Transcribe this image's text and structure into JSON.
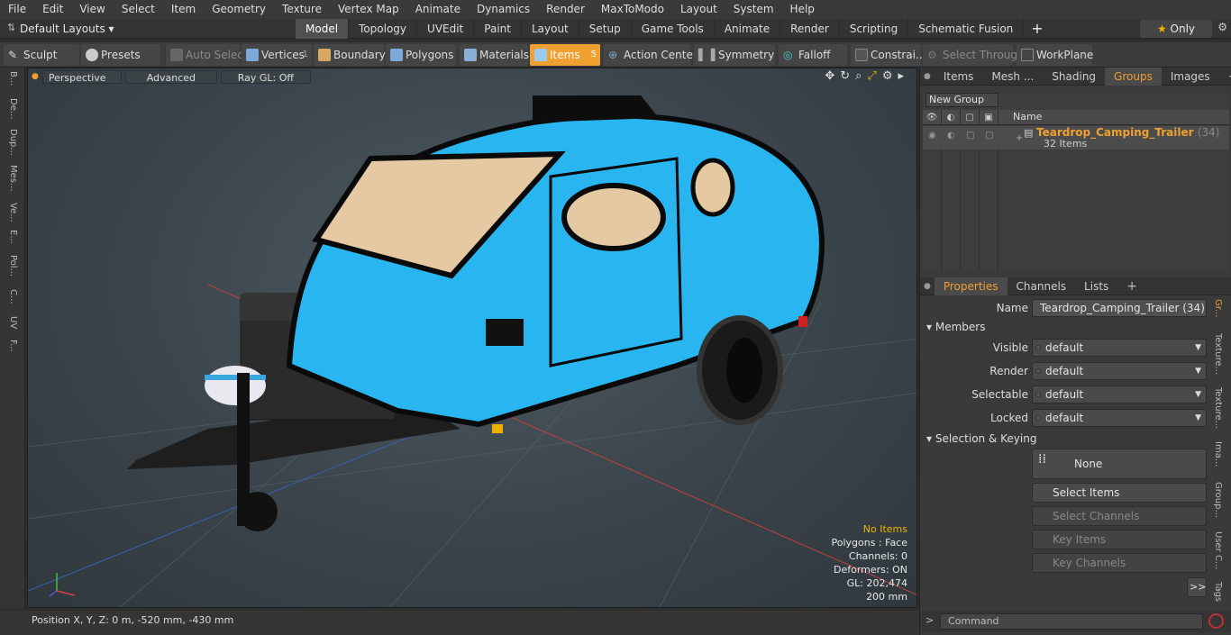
{
  "menu": [
    "File",
    "Edit",
    "View",
    "Select",
    "Item",
    "Geometry",
    "Texture",
    "Vertex Map",
    "Animate",
    "Dynamics",
    "Render",
    "MaxToModo",
    "Layout",
    "System",
    "Help"
  ],
  "layouts": {
    "label": "Default Layouts"
  },
  "modes": {
    "tabs": [
      "Model",
      "Topology",
      "UVEdit",
      "Paint",
      "Layout",
      "Setup",
      "Game Tools",
      "Animate",
      "Render",
      "Scripting",
      "Schematic Fusion"
    ],
    "active": "Model",
    "only_label": "Only"
  },
  "toolbar": {
    "sculpt": "Sculpt",
    "presets": "Presets",
    "auto_select": "Auto Select",
    "vertices": "Vertices",
    "vertices_count": "1",
    "boundary": "Boundary",
    "polygons": "Polygons",
    "materials": "Materials",
    "items": "Items",
    "items_count": "5",
    "action_center": "Action Center",
    "symmetry": "Symmetry",
    "falloff": "Falloff",
    "constraints": "Constrai...",
    "select_through": "Select Through",
    "workplane": "WorkPlane"
  },
  "left_tabs": [
    "B...",
    "De...",
    "Dup...",
    "Mes...",
    "Ve...",
    "E...",
    "Pol...",
    "C...",
    "UV",
    "F..."
  ],
  "viewport": {
    "view": "Perspective",
    "shading": "Advanced",
    "raygl": "Ray GL: Off",
    "hud": {
      "no_items": "No Items",
      "polygons": "Polygons : Face",
      "channels": "Channels: 0",
      "deformers": "Deformers: ON",
      "gl": "GL: 202,474",
      "scale": "200 mm"
    }
  },
  "status": {
    "position": "Position X, Y, Z:   0 m, -520 mm, -430 mm"
  },
  "right_top_tabs": [
    "Items",
    "Mesh ...",
    "Shading",
    "Groups",
    "Images"
  ],
  "right_top_active": "Groups",
  "groups": {
    "new_group": "New Group",
    "col_name": "Name",
    "group_name": "Teardrop_Camping_Trailer",
    "group_count": "(34)",
    "group_items": "32 Items"
  },
  "props_tabs": [
    "Properties",
    "Channels",
    "Lists"
  ],
  "props": {
    "name_label": "Name",
    "name_value": "Teardrop_Camping_Trailer (34)",
    "members": "Members",
    "visible_label": "Visible",
    "visible": "default",
    "render_label": "Render",
    "render": "default",
    "selectable_label": "Selectable",
    "selectable": "default",
    "locked_label": "Locked",
    "locked": "default",
    "sel_keying": "Selection & Keying",
    "none": "None",
    "select_items": "Select Items",
    "select_channels": "Select Channels",
    "key_items": "Key Items",
    "key_channels": "Key Channels",
    "more": ">>"
  },
  "right_vtabs": [
    "Gr...",
    "Texture...",
    "Texture...",
    "Ima...",
    "Group...",
    "User C...",
    "Tags"
  ],
  "command": {
    "placeholder": "Command"
  },
  "colors": {
    "accent": "#f0a030",
    "trailer": "#29b6f0"
  }
}
